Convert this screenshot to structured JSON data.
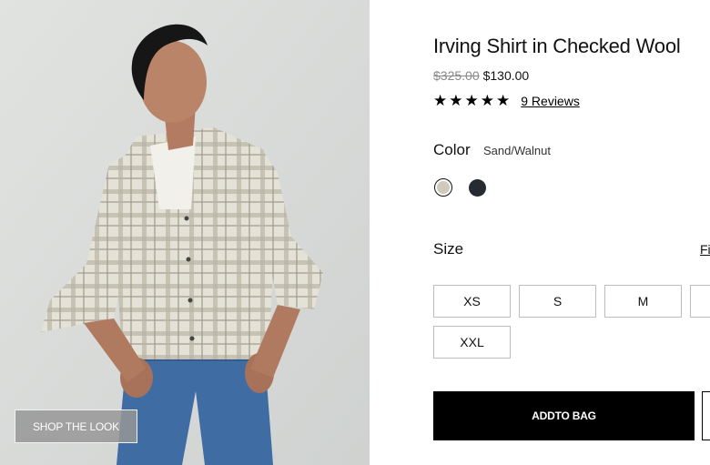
{
  "product": {
    "title": "Irving Shirt in Checked Wool",
    "original_price": "$325.00",
    "sale_price": "$130.00",
    "rating_stars": 5,
    "reviews_label": "9 Reviews"
  },
  "color": {
    "label": "Color",
    "selected": "Sand/Walnut",
    "swatches": [
      {
        "name": "Sand/Walnut",
        "hex": "#cfcbbb",
        "selected": true
      },
      {
        "name": "Navy",
        "hex": "#252a33",
        "selected": false
      }
    ]
  },
  "size": {
    "label": "Size",
    "fit_link": "Fi",
    "options": [
      "XS",
      "S",
      "M",
      "",
      "XXL"
    ]
  },
  "actions": {
    "add_to_bag": "ADDTO BAG",
    "shop_the_look": "SHOP THE LOOK"
  },
  "colors": {
    "accent": "#000000",
    "background": "#ffffff",
    "photo_bg": "#d9dcda"
  }
}
